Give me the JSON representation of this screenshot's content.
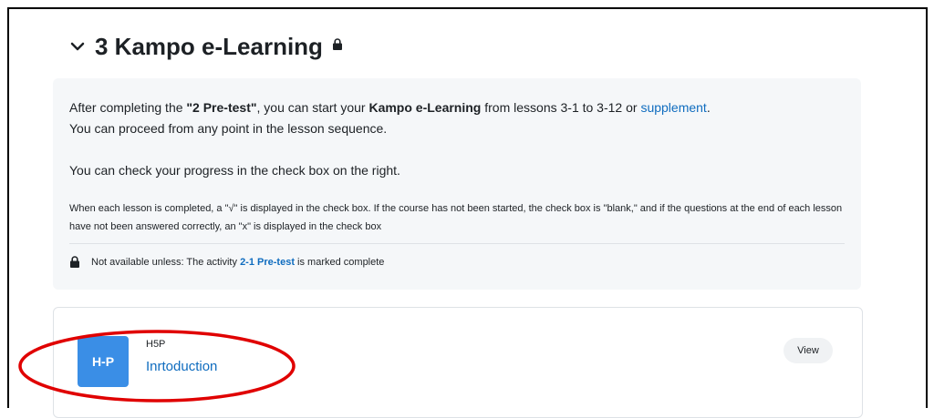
{
  "section": {
    "title": "3 Kampo e-Learning",
    "summary": {
      "p1_before": "After completing the ",
      "p1_bold1": "\"2 Pre-test\"",
      "p1_mid": ", you can start your ",
      "p1_bold2": "Kampo e-Learning",
      "p1_after": " from lessons 3-1 to 3-12 or ",
      "p1_link": "supplement",
      "p1_end": ".",
      "p2": "You can proceed from any point in the lesson sequence.",
      "p3": "You can check your progress in the check box on the right.",
      "p4": "When each lesson is completed, a \"√\" is displayed in the check box. If the course has not been started, the check box is \"blank,\" and if the questions at the end of each lesson have not been answered correctly, an \"x\" is displayed in the check box"
    },
    "restriction": {
      "prefix": "Not available unless: The activity ",
      "link": "2-1 Pre-test",
      "suffix": " is marked complete"
    }
  },
  "activity": {
    "icon_text": "H-P",
    "type": "H5P",
    "name": "Inrtoduction",
    "view_label": "View"
  },
  "colors": {
    "link": "#0f6cbf",
    "h5p_icon": "#3a8ee6",
    "annotation": "#e00000"
  }
}
